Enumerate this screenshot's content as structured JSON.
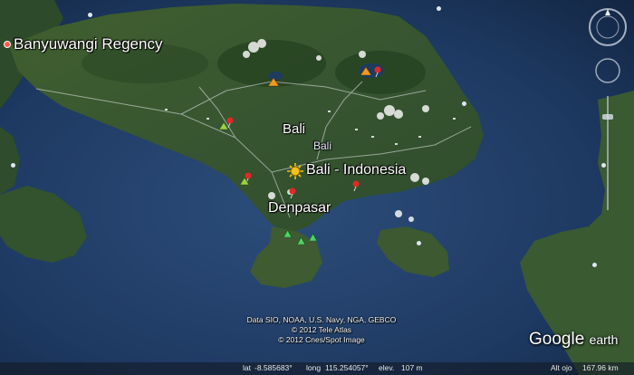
{
  "map": {
    "labels": {
      "banyuwangi": "Banyuwangi Regency",
      "bali_island": "Bali",
      "bali_sub": "Bali",
      "placemark": "Bali - Indonesia",
      "denpasar": "Denpasar"
    },
    "attribution": {
      "line1": "Data SIO, NOAA, U.S. Navy, NGA, GEBCO",
      "line2": "© 2012 Tele Atlas",
      "line3": "© 2012 Cnes/Spot Image"
    },
    "brand": {
      "word1": "Google",
      "word2": "earth"
    },
    "status": {
      "lat_label": "lat",
      "lat_value": "-8.585683°",
      "lon_label": "long",
      "lon_value": "115.254057°",
      "elev_label": "elev.",
      "elev_value": "107 m",
      "alt_label": "Alt ojo",
      "alt_value": "167.96 km"
    },
    "colors": {
      "ocean_deep": "#15294a",
      "ocean": "#23406a",
      "land": "#3b5a2f",
      "land_dark": "#2a4424",
      "placemark": "#f3c21a",
      "road": "#e9ecf0"
    },
    "icons": [
      "compass-icon",
      "look-joystick-icon",
      "move-joystick-icon",
      "zoom-slider-icon",
      "placemark-sun-icon",
      "pushpin-icon",
      "mountain-icon",
      "info-icon"
    ]
  }
}
